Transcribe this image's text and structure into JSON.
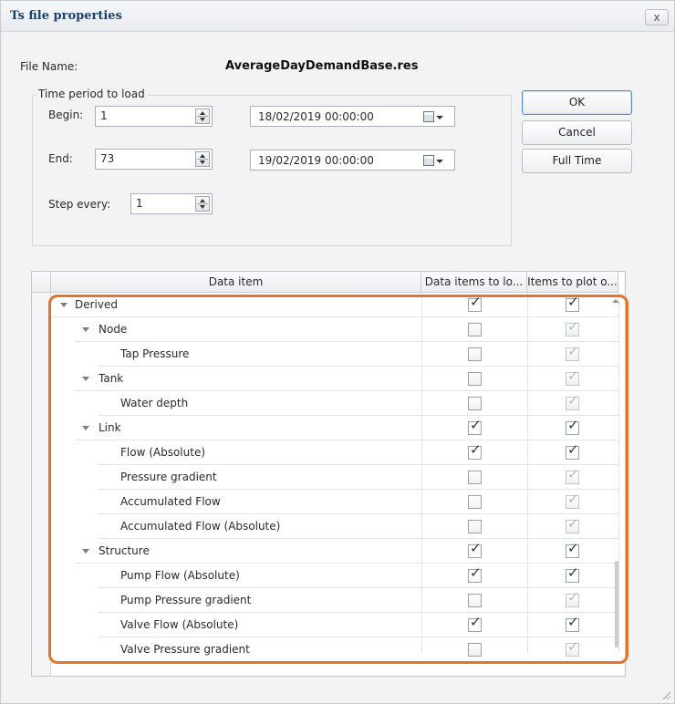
{
  "window": {
    "title": "Ts file properties",
    "close_label": "x"
  },
  "file": {
    "label": "File Name:",
    "value": "AverageDayDemandBase.res"
  },
  "time_period": {
    "caption": "Time period  to load",
    "begin_label": "Begin:",
    "begin_value": "1",
    "begin_date": "18/02/2019 00:00:00",
    "end_label": "End:",
    "end_value": "73",
    "end_date": "19/02/2019 00:00:00",
    "step_label": "Step every:",
    "step_value": "1"
  },
  "buttons": {
    "ok": "OK",
    "cancel": "Cancel",
    "full_time": "Full Time"
  },
  "grid": {
    "columns": [
      "Data item",
      "Data items to lo...",
      "Items to plot o..."
    ],
    "rows": [
      {
        "label": "Derived",
        "level": 0,
        "expander": true,
        "load": "checked",
        "plot": "checked"
      },
      {
        "label": "Node",
        "level": 1,
        "expander": true,
        "load": "unchecked",
        "plot": "checked-disabled"
      },
      {
        "label": "Tap Pressure",
        "level": 2,
        "expander": false,
        "load": "unchecked",
        "plot": "checked-disabled"
      },
      {
        "label": "Tank",
        "level": 1,
        "expander": true,
        "load": "unchecked",
        "plot": "checked-disabled"
      },
      {
        "label": "Water depth",
        "level": 2,
        "expander": false,
        "load": "unchecked",
        "plot": "checked-disabled"
      },
      {
        "label": "Link",
        "level": 1,
        "expander": true,
        "load": "checked",
        "plot": "checked"
      },
      {
        "label": "Flow (Absolute)",
        "level": 2,
        "expander": false,
        "load": "checked",
        "plot": "checked"
      },
      {
        "label": "Pressure gradient",
        "level": 2,
        "expander": false,
        "load": "unchecked",
        "plot": "checked-disabled"
      },
      {
        "label": "Accumulated Flow",
        "level": 2,
        "expander": false,
        "load": "unchecked",
        "plot": "checked-disabled"
      },
      {
        "label": "Accumulated Flow (Absolute)",
        "level": 2,
        "expander": false,
        "load": "unchecked",
        "plot": "checked-disabled"
      },
      {
        "label": "Structure",
        "level": 1,
        "expander": true,
        "load": "checked",
        "plot": "checked"
      },
      {
        "label": "Pump Flow (Absolute)",
        "level": 2,
        "expander": false,
        "load": "checked",
        "plot": "checked"
      },
      {
        "label": "Pump Pressure gradient",
        "level": 2,
        "expander": false,
        "load": "unchecked",
        "plot": "checked-disabled"
      },
      {
        "label": "Valve Flow (Absolute)",
        "level": 2,
        "expander": false,
        "load": "checked",
        "plot": "checked"
      },
      {
        "label": "Valve Pressure gradient",
        "level": 2,
        "expander": false,
        "load": "unchecked",
        "plot": "checked-disabled"
      }
    ]
  },
  "colors": {
    "highlight": "#e2742d",
    "title": "#1d3f6e",
    "default_button_border": "#5b8bc7"
  },
  "icons": {
    "close": "close-icon",
    "calendar": "calendar-icon",
    "expander": "collapse-arrow-icon",
    "check": "check-icon"
  }
}
